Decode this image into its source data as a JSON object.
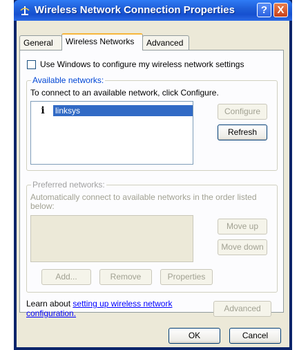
{
  "window": {
    "title": "Wireless Network Connection Properties",
    "help_label": "?",
    "close_label": "X"
  },
  "tabs": [
    {
      "label": "General",
      "active": false
    },
    {
      "label": "Wireless Networks",
      "active": true
    },
    {
      "label": "Advanced",
      "active": false
    }
  ],
  "use_windows_checkbox": {
    "label": "Use Windows to configure my wireless network settings",
    "checked": false
  },
  "available": {
    "group_title": "Available networks:",
    "instruction": "To connect to an available network, click Configure.",
    "networks": [
      {
        "name": "linksys",
        "icon": "info-icon",
        "icon_glyph": "i"
      }
    ],
    "configure_label": "Configure",
    "refresh_label": "Refresh"
  },
  "preferred": {
    "group_title": "Preferred networks:",
    "description_line1": "Automatically connect to available networks in the order listed",
    "description_line2": "below:",
    "move_up_label": "Move up",
    "move_down_label": "Move down",
    "add_label": "Add...",
    "remove_label": "Remove",
    "properties_label": "Properties"
  },
  "learn": {
    "prefix": "Learn about ",
    "link_line1": "setting up wireless network",
    "link_line2": "configuration.",
    "advanced_label": "Advanced"
  },
  "footer": {
    "ok_label": "OK",
    "cancel_label": "Cancel"
  },
  "colors": {
    "title_bar": "#1f5fd9",
    "selection": "#316ac5",
    "group_title": "#0046d5",
    "link": "#0000ff"
  }
}
